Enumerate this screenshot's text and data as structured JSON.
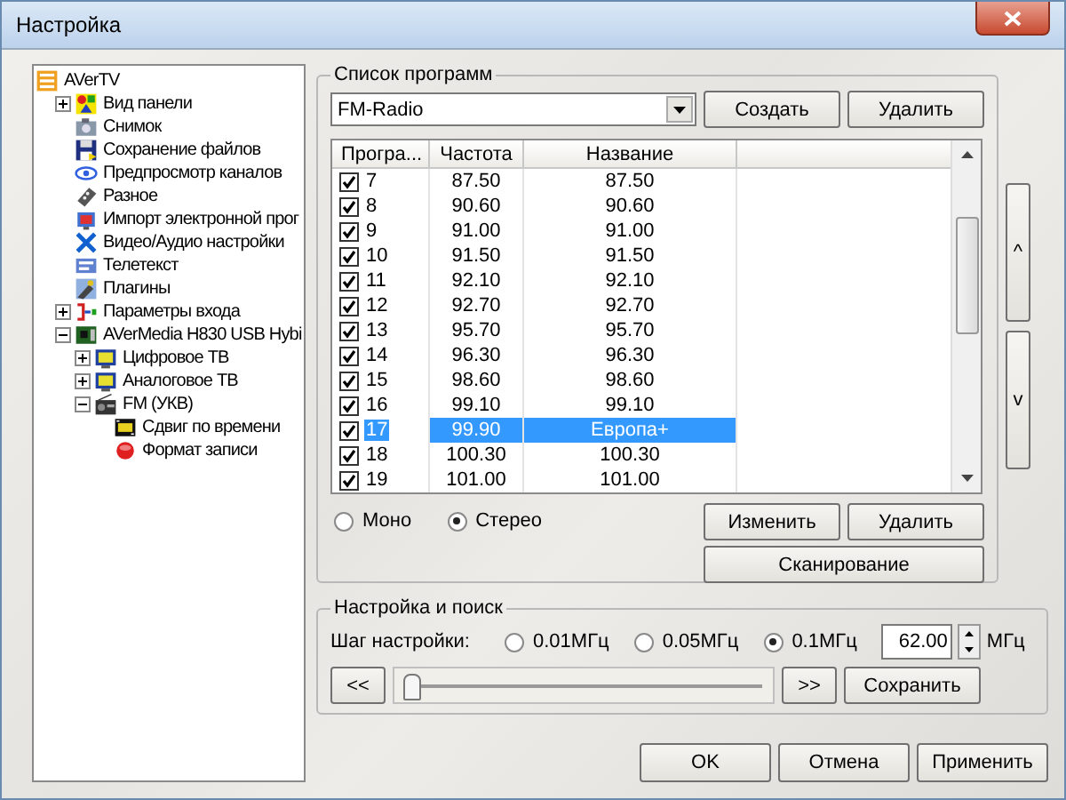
{
  "window": {
    "title": "Настройка"
  },
  "tree": {
    "label": "AVerTV",
    "children": [
      {
        "label": "Вид панели",
        "expanded": false
      },
      {
        "label": "Снимок"
      },
      {
        "label": "Сохранение файлов"
      },
      {
        "label": "Предпросмотр каналов"
      },
      {
        "label": "Разное"
      },
      {
        "label": "Импорт электронной прог"
      },
      {
        "label": "Видео/Аудио настройки"
      },
      {
        "label": "Телетекст"
      },
      {
        "label": "Плагины"
      },
      {
        "label": "Параметры входа",
        "expanded": false
      },
      {
        "label": "AVerMedia H830 USB Hybi",
        "expanded": true,
        "children": [
          {
            "label": "Цифровое ТВ",
            "expanded": false
          },
          {
            "label": "Аналоговое ТВ",
            "expanded": false
          },
          {
            "label": "FM (УКВ)",
            "expanded": true,
            "children": [
              {
                "label": "Сдвиг по времени"
              },
              {
                "label": "Формат записи"
              }
            ]
          }
        ]
      }
    ]
  },
  "program_list": {
    "title": "Список программ",
    "preset": "FM-Radio",
    "buttons": [
      "Создать",
      "Удалить"
    ],
    "table": {
      "columns": [
        "Програ...",
        "Частота",
        "Название"
      ],
      "rows": [
        {
          "cells": [
            "7",
            "87.50",
            "87.50"
          ],
          "checked": true,
          "selected": false
        },
        {
          "cells": [
            "8",
            "90.60",
            "90.60"
          ],
          "checked": true,
          "selected": false
        },
        {
          "cells": [
            "9",
            "91.00",
            "91.00"
          ],
          "checked": true,
          "selected": false
        },
        {
          "cells": [
            "10",
            "91.50",
            "91.50"
          ],
          "checked": true,
          "selected": false
        },
        {
          "cells": [
            "11",
            "92.10",
            "92.10"
          ],
          "checked": true,
          "selected": false
        },
        {
          "cells": [
            "12",
            "92.70",
            "92.70"
          ],
          "checked": true,
          "selected": false
        },
        {
          "cells": [
            "13",
            "95.70",
            "95.70"
          ],
          "checked": true,
          "selected": false
        },
        {
          "cells": [
            "14",
            "96.30",
            "96.30"
          ],
          "checked": true,
          "selected": false
        },
        {
          "cells": [
            "15",
            "98.60",
            "98.60"
          ],
          "checked": true,
          "selected": false
        },
        {
          "cells": [
            "16",
            "99.10",
            "99.10"
          ],
          "checked": true,
          "selected": false
        },
        {
          "cells": [
            "17",
            "99.90",
            "Европа+"
          ],
          "checked": true,
          "selected": true
        },
        {
          "cells": [
            "18",
            "100.30",
            "100.30"
          ],
          "checked": true,
          "selected": false
        },
        {
          "cells": [
            "19",
            "101.00",
            "101.00"
          ],
          "checked": true,
          "selected": false
        }
      ]
    },
    "audio_modes": [
      {
        "label": "Моно",
        "selected": false
      },
      {
        "label": "Стерео",
        "selected": true
      }
    ],
    "actions": [
      "Изменить",
      "Удалить",
      "Сканирование"
    ]
  },
  "move_buttons": [
    "^",
    "v"
  ],
  "tuning": {
    "title": "Настройка и поиск",
    "step_label": "Шаг настройки:",
    "steps": [
      {
        "label": "0.01МГц",
        "selected": false
      },
      {
        "label": "0.05МГц",
        "selected": false
      },
      {
        "label": "0.1МГц",
        "selected": true
      }
    ],
    "frequency": "62.00",
    "unit": "МГц",
    "prev": "<<",
    "next": ">>",
    "slider": {
      "level": 0.02
    },
    "save": "Сохранить"
  },
  "dialog_buttons": [
    "OK",
    "Отмена",
    "Применить"
  ]
}
